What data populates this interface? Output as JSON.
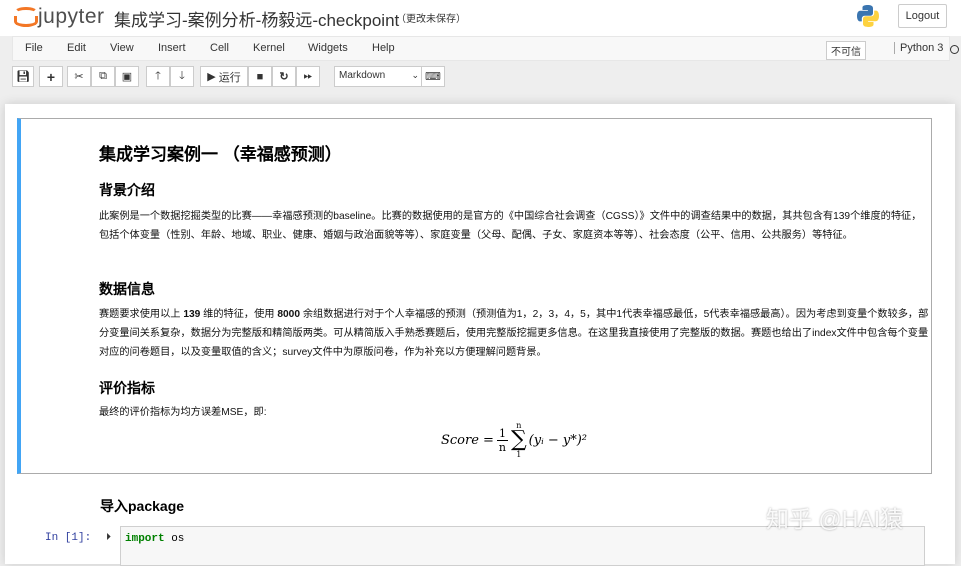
{
  "header": {
    "logo_text": "jupyter",
    "notebook_title": "集成学习-案例分析-杨毅远-checkpoint",
    "save_status": "（更改未保存）",
    "logout": "Logout"
  },
  "menubar": {
    "items": [
      "File",
      "Edit",
      "View",
      "Insert",
      "Cell",
      "Kernel",
      "Widgets",
      "Help"
    ],
    "trusted": "不可信",
    "kernel": "Python 3"
  },
  "toolbar": {
    "run_label": "运行",
    "cell_type": "Markdown"
  },
  "cell1": {
    "title": "集成学习案例一 （幸福感预测）",
    "s1_heading": "背景介绍",
    "s1_text": "此案例是一个数据挖掘类型的比赛——幸福感预测的baseline。比赛的数据使用的是官方的《中国综合社会调查（CGSS）》文件中的调查结果中的数据，其共包含有139个维度的特征，包括个体变量（性别、年龄、地域、职业、健康、婚姻与政治面貌等等）、家庭变量（父母、配偶、子女、家庭资本等等）、社会态度（公平、信用、公共服务）等特征。",
    "s2_heading": "数据信息",
    "s2_text_a": "赛题要求使用以上 ",
    "s2_bold1": "139",
    "s2_text_b": " 维的特征，使用 ",
    "s2_bold2": "8000",
    "s2_text_c": " 余组数据进行对于个人幸福感的预测（预测值为1，2，3，4，5，其中1代表幸福感最低，5代表幸福感最高）。因为考虑到变量个数较多，部分变量间关系复杂，数据分为完整版和精简版两类。可从精简版入手熟悉赛题后，使用完整版挖掘更多信息。在这里我直接使用了完整版的数据。赛题也给出了index文件中包含每个变量对应的问卷题目，以及变量取值的含义；survey文件中为原版问卷，作为补充以方便理解问题背景。",
    "s3_heading": "评价指标",
    "s3_text": "最终的评价指标为均方误差MSE，即:",
    "formula": {
      "lhs": "Score =",
      "num": "1",
      "den": "n",
      "sum_top": "n",
      "sum_bot": "1",
      "body": "(yᵢ − y*)²"
    }
  },
  "cell2": {
    "heading": "导入package"
  },
  "cell3": {
    "prompt": "In [1]:",
    "kw": "import",
    "rest": " os"
  },
  "watermark": "知乎 @HAI猿",
  "colors": {
    "selected_bar": "#42a5f5",
    "logo": "#f37726"
  }
}
